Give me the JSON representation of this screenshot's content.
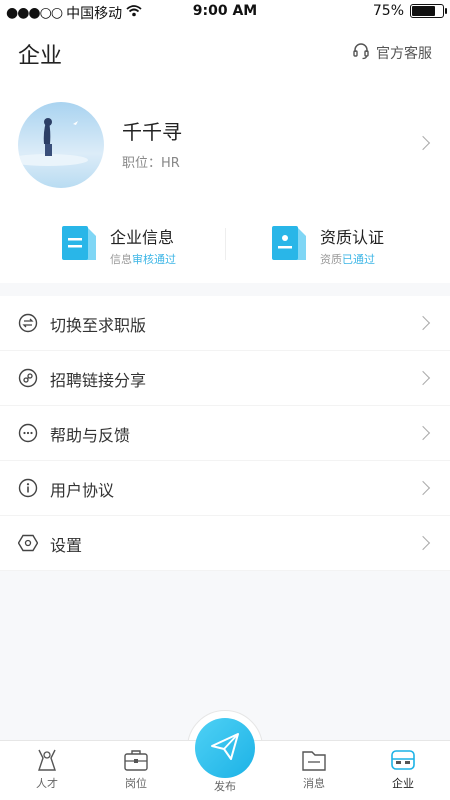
{
  "status": {
    "carrier": "中国移动",
    "time": "9:00 AM",
    "battery": "75%",
    "battery_level": 0.75
  },
  "header": {
    "title": "企业",
    "service_label": "官方客服"
  },
  "profile": {
    "name": "千千寻",
    "role": "职位：HR"
  },
  "cards": [
    {
      "title": "企业信息",
      "sub_prefix": "信息",
      "sub_status": "审核通过"
    },
    {
      "title": "资质认证",
      "sub_prefix": "资质",
      "sub_status": "已通过"
    }
  ],
  "menu": [
    {
      "label": "切换至求职版",
      "icon": "switch-icon"
    },
    {
      "label": "招聘链接分享",
      "icon": "link-icon"
    },
    {
      "label": "帮助与反馈",
      "icon": "chat-icon"
    },
    {
      "label": "用户协议",
      "icon": "info-icon"
    },
    {
      "label": "设置",
      "icon": "settings-icon"
    }
  ],
  "tabs": [
    {
      "label": "人才",
      "icon": "talent-icon"
    },
    {
      "label": "岗位",
      "icon": "briefcase-icon"
    },
    {
      "label": "发布",
      "icon": "paper-plane-icon"
    },
    {
      "label": "消息",
      "icon": "message-icon"
    },
    {
      "label": "企业",
      "icon": "company-icon",
      "active": true
    }
  ],
  "colors": {
    "accent": "#1cb2e6",
    "highlight": "#3db6e6"
  }
}
